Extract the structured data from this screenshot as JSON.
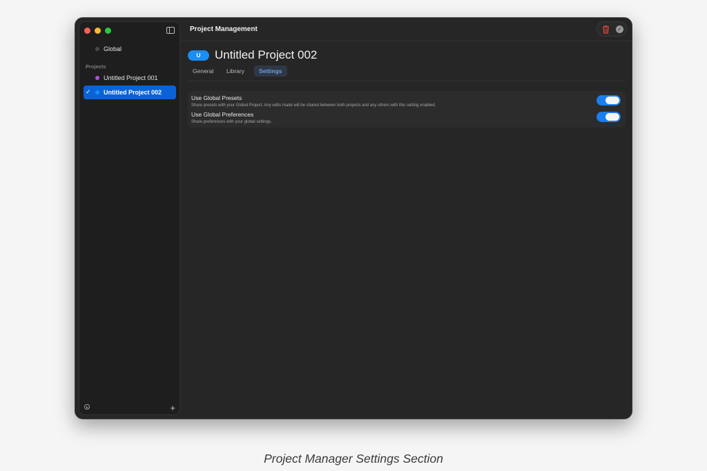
{
  "window": {
    "title": "Project Management"
  },
  "sidebar": {
    "global_item": {
      "label": "Global",
      "dot_color": "#4a4a4a"
    },
    "section_label": "Projects",
    "projects": [
      {
        "label": "Untitled Project 001",
        "dot_color": "#b24fe0",
        "selected": false
      },
      {
        "label": "Untitled Project 002",
        "dot_color": "#1a8ef3",
        "selected": true
      }
    ],
    "check_glyph": "✓",
    "add_glyph": "+",
    "icons": {
      "toggle": "sidebar-toggle-icon",
      "bottom_left": "clock-icon"
    }
  },
  "title_actions": {
    "delete_icon": "trash-icon",
    "confirm_icon": "checkmark-circle-icon",
    "confirm_glyph": "✓"
  },
  "project": {
    "badge": "U",
    "title": "Untitled Project 002",
    "accent_color": "#1a8ef3"
  },
  "tabs": [
    {
      "label": "General",
      "active": false
    },
    {
      "label": "Library",
      "active": false
    },
    {
      "label": "Settings",
      "active": true
    }
  ],
  "settings": [
    {
      "title": "Use Global Presets",
      "description": "Share presets with your Global Project. Any edits made will be shared between both projects and any others with this setting enabled.",
      "enabled": true
    },
    {
      "title": "Use Global Preferences",
      "description": "Share preferences with your global settings.",
      "enabled": true
    }
  ],
  "colors": {
    "selection": "#0a63d6",
    "toggle_on": "#1a7ef0",
    "delete": "#e5483f"
  },
  "caption": "Project Manager Settings Section"
}
